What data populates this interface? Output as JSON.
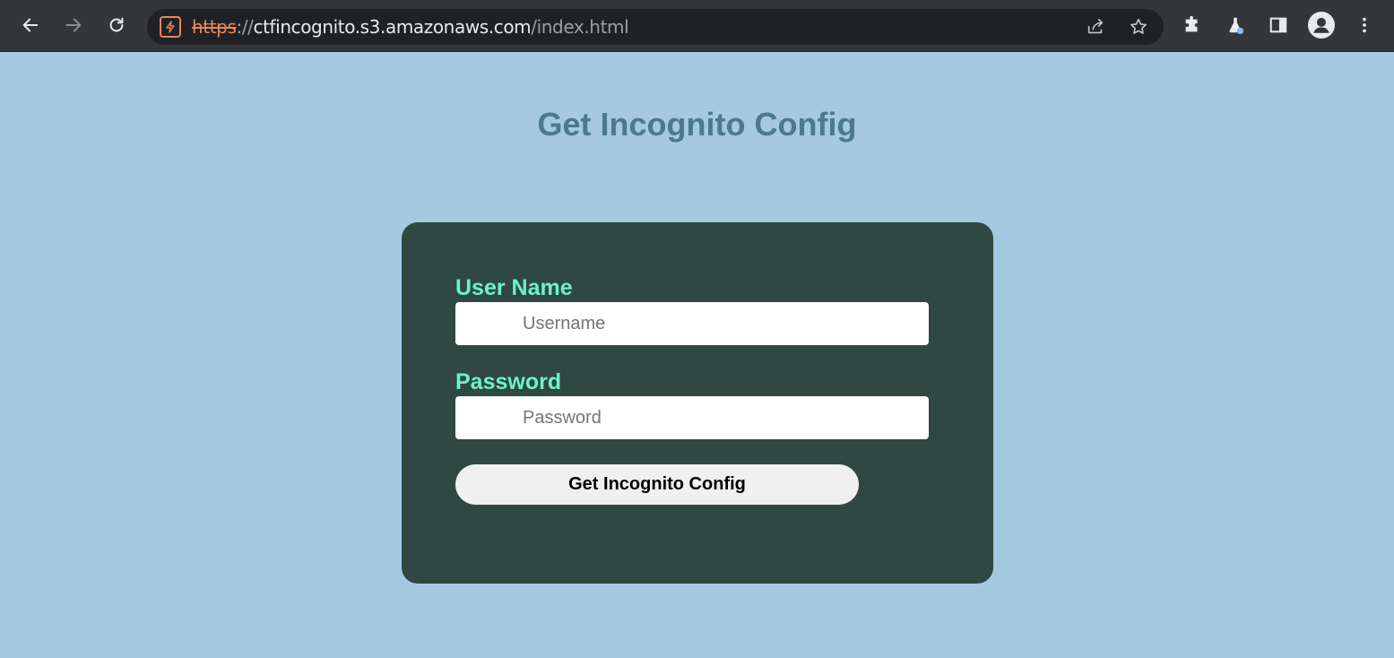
{
  "browser": {
    "url": {
      "scheme": "https",
      "separator": "://",
      "host": "ctfincognito.s3.amazonaws.com",
      "path": "/index.html"
    },
    "icons": {
      "back": "arrow-left-icon",
      "forward": "arrow-right-icon",
      "reload": "reload-icon",
      "site_info": "not-secure-icon",
      "share": "share-icon",
      "bookmark": "star-icon",
      "extensions": "puzzle-icon",
      "labs": "flask-icon",
      "side_panel": "side-panel-icon",
      "profile": "avatar-icon",
      "menu": "kebab-menu-icon"
    }
  },
  "page": {
    "title": "Get Incognito Config",
    "form": {
      "username_label": "User Name",
      "username_placeholder": "Username",
      "password_label": "Password",
      "password_placeholder": "Password",
      "submit_label": "Get Incognito Config"
    }
  },
  "colors": {
    "page_background": "#a4c9e0",
    "title": "#4a7a8c",
    "card": "#2f4842",
    "label": "#6ef2c8",
    "button": "#f0f0f0"
  }
}
